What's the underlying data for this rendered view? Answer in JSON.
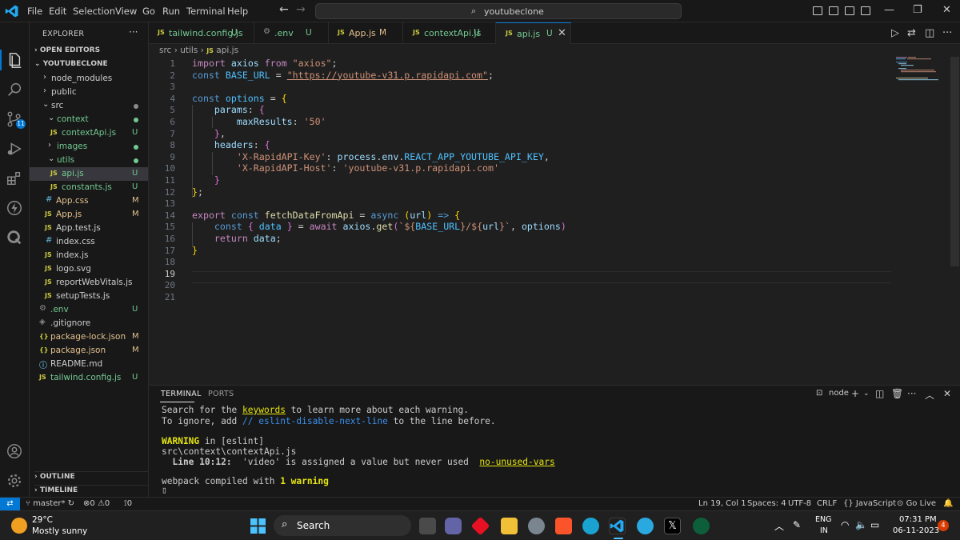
{
  "menu": [
    "File",
    "Edit",
    "Selection",
    "View",
    "Go",
    "Run",
    "Terminal",
    "Help"
  ],
  "command_center": "youtubeclone",
  "explorer": {
    "title": "EXPLORER",
    "open_editors": "OPEN EDITORS",
    "project": "YOUTUBECLONE",
    "items": [
      {
        "label": "node_modules",
        "status": ""
      },
      {
        "label": "public",
        "status": ""
      },
      {
        "label": "src",
        "status": ""
      },
      {
        "label": "context",
        "status": ""
      },
      {
        "label": "contextApi.js",
        "status": "U",
        "icon": "JS"
      },
      {
        "label": "images",
        "status": ""
      },
      {
        "label": "utils",
        "status": ""
      },
      {
        "label": "api.js",
        "status": "U",
        "icon": "JS"
      },
      {
        "label": "constants.js",
        "status": "U",
        "icon": "JS"
      },
      {
        "label": "App.css",
        "status": "M",
        "icon": "#"
      },
      {
        "label": "App.js",
        "status": "M",
        "icon": "JS"
      },
      {
        "label": "App.test.js",
        "status": "",
        "icon": "JS"
      },
      {
        "label": "index.css",
        "status": "",
        "icon": "#"
      },
      {
        "label": "index.js",
        "status": "",
        "icon": "JS"
      },
      {
        "label": "logo.svg",
        "status": "",
        "icon": "JS"
      },
      {
        "label": "reportWebVitals.js",
        "status": "",
        "icon": "JS"
      },
      {
        "label": "setupTests.js",
        "status": "",
        "icon": "JS"
      },
      {
        "label": ".env",
        "status": "U",
        "icon": "⚙"
      },
      {
        "label": ".gitignore",
        "status": "",
        "icon": "◈"
      },
      {
        "label": "package-lock.json",
        "status": "M",
        "icon": "{}"
      },
      {
        "label": "package.json",
        "status": "M",
        "icon": "{}"
      },
      {
        "label": "README.md",
        "status": "",
        "icon": "ⓘ"
      },
      {
        "label": "tailwind.config.js",
        "status": "U",
        "icon": "JS"
      }
    ],
    "outline": "OUTLINE",
    "timeline": "TIMELINE"
  },
  "tabs": [
    {
      "label": "tailwind.config.js",
      "status": "U",
      "icon": "JS"
    },
    {
      "label": ".env",
      "status": "U",
      "icon": "⚙"
    },
    {
      "label": "App.js",
      "status": "M",
      "icon": "JS"
    },
    {
      "label": "contextApi.js",
      "status": "U",
      "icon": "JS"
    },
    {
      "label": "api.js",
      "status": "U",
      "icon": "JS"
    }
  ],
  "breadcrumb": {
    "parts": [
      "src",
      "utils"
    ],
    "file": "api.js",
    "file_icon": "JS"
  },
  "editor": {
    "line_numbers": [
      "1",
      "2",
      "3",
      "4",
      "5",
      "6",
      "7",
      "8",
      "9",
      "10",
      "11",
      "12",
      "13",
      "14",
      "15",
      "16",
      "17",
      "18",
      "19",
      "20",
      "21"
    ],
    "current_line": "19"
  },
  "panel": {
    "tabs": [
      "TERMINAL",
      "PORTS"
    ],
    "shell": "node",
    "lines": {
      "l1a": "Search for the ",
      "l1b": "keywords",
      "l1c": " to learn more about each warning.",
      "l2a": "To ignore, add ",
      "l2b": "// eslint-disable-next-line",
      "l2c": " to the line before.",
      "l3a": "WARNING",
      "l3b": " in [eslint]",
      "l4": "src\\context\\contextApi.js",
      "l5a": "  Line 10:12:",
      "l5b": "  'video' is assigned a value but never used  ",
      "l5c": "no-unused-vars",
      "l6a": "webpack compiled with ",
      "l6b": "1 warning",
      "cursor": "▯"
    }
  },
  "statusbar": {
    "branch": "master*",
    "errors": "0",
    "warnings": "0",
    "ports": "0",
    "position": "Ln 19, Col 1",
    "spaces": "Spaces: 4",
    "encoding": "UTF-8",
    "eol": "CRLF",
    "language": "JavaScript",
    "golive": "Go Live"
  },
  "taskbar": {
    "temp": "29°C",
    "weather": "Mostly sunny",
    "search": "Search",
    "lang1": "ENG",
    "lang2": "IN",
    "time": "07:31 PM",
    "date": "06-11-2023",
    "notifications": "4"
  },
  "colors": {
    "accent": "#0078d4",
    "untracked": "#73c991",
    "modified": "#e2c08d"
  }
}
